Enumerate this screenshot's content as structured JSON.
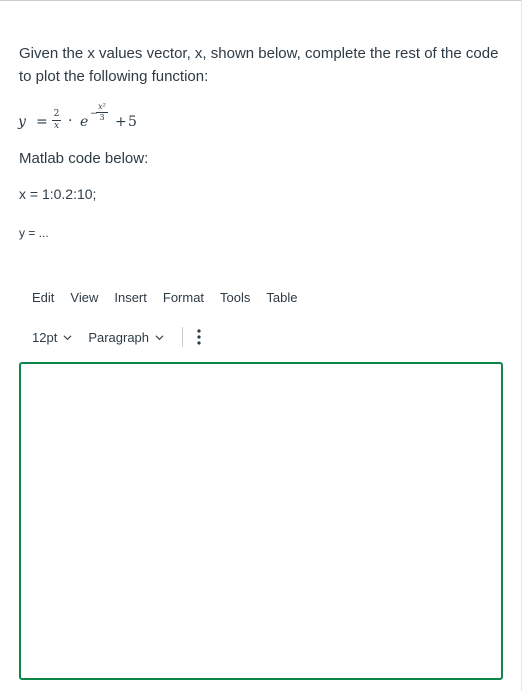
{
  "question": {
    "prompt": "Given the x values vector, x, shown below, complete the rest of the code to plot the following function:"
  },
  "formula": {
    "lhs": "y",
    "equals": "=",
    "frac_num": "2",
    "frac_den": "x",
    "dot": "·",
    "base": "e",
    "exp_sign": "−",
    "exp_num": "x²",
    "exp_den": "3",
    "plus": "+",
    "constant": "5"
  },
  "code_label": "Matlab code below:",
  "code_lines": {
    "line1": "x = 1:0.2:10;",
    "line2": "y = ..."
  },
  "editor": {
    "menu": [
      "Edit",
      "View",
      "Insert",
      "Format",
      "Tools",
      "Table"
    ],
    "font_size": "12pt",
    "block_format": "Paragraph",
    "more_icon": "vertical-ellipsis",
    "content": ""
  },
  "colors": {
    "text": "#2d3b45",
    "editor_border_focus": "#0b874b"
  }
}
